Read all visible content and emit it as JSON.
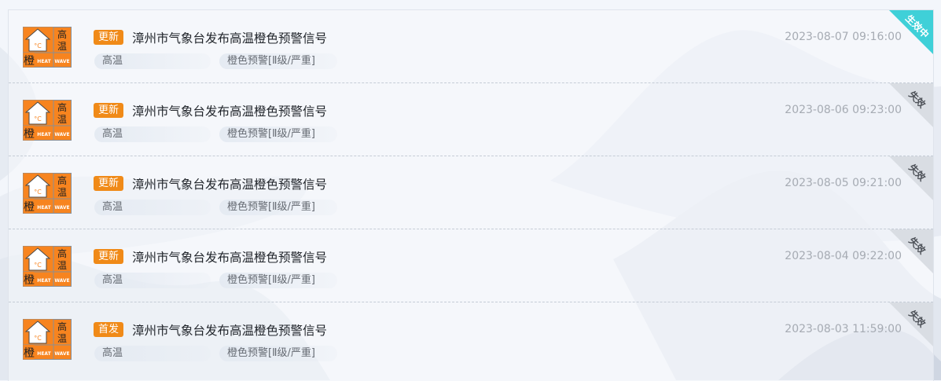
{
  "warnings": [
    {
      "badge": "更新",
      "title": "漳州市气象台发布高温橙色预警信号",
      "type": "高温",
      "level": "橙色预警[Ⅱ级/严重]",
      "time": "2023-08-07 09:16:00",
      "status": "生效中",
      "icon": {
        "corner": "高温",
        "bottom": "橙",
        "unit": "°C",
        "en1": "HEAT",
        "en2": "WAVE"
      }
    },
    {
      "badge": "更新",
      "title": "漳州市气象台发布高温橙色预警信号",
      "type": "高温",
      "level": "橙色预警[Ⅱ级/严重]",
      "time": "2023-08-06 09:23:00",
      "status": "失效",
      "icon": {
        "corner": "高温",
        "bottom": "橙",
        "unit": "°C",
        "en1": "HEAT",
        "en2": "WAVE"
      }
    },
    {
      "badge": "更新",
      "title": "漳州市气象台发布高温橙色预警信号",
      "type": "高温",
      "level": "橙色预警[Ⅱ级/严重]",
      "time": "2023-08-05 09:21:00",
      "status": "失效",
      "icon": {
        "corner": "高温",
        "bottom": "橙",
        "unit": "°C",
        "en1": "HEAT",
        "en2": "WAVE"
      }
    },
    {
      "badge": "更新",
      "title": "漳州市气象台发布高温橙色预警信号",
      "type": "高温",
      "level": "橙色预警[Ⅱ级/严重]",
      "time": "2023-08-04 09:22:00",
      "status": "失效",
      "icon": {
        "corner": "高温",
        "bottom": "橙",
        "unit": "°C",
        "en1": "HEAT",
        "en2": "WAVE"
      }
    },
    {
      "badge": "首发",
      "title": "漳州市气象台发布高温橙色预警信号",
      "type": "高温",
      "level": "橙色预警[Ⅱ级/严重]",
      "time": "2023-08-03 11:59:00",
      "status": "失效",
      "icon": {
        "corner": "高温",
        "bottom": "橙",
        "unit": "°C",
        "en1": "HEAT",
        "en2": "WAVE"
      }
    }
  ],
  "colors": {
    "badge": "#f08a18",
    "warning_orange": "#f7841f",
    "active_status": "#3fd0d8",
    "expired_status": "#d9dde3"
  }
}
